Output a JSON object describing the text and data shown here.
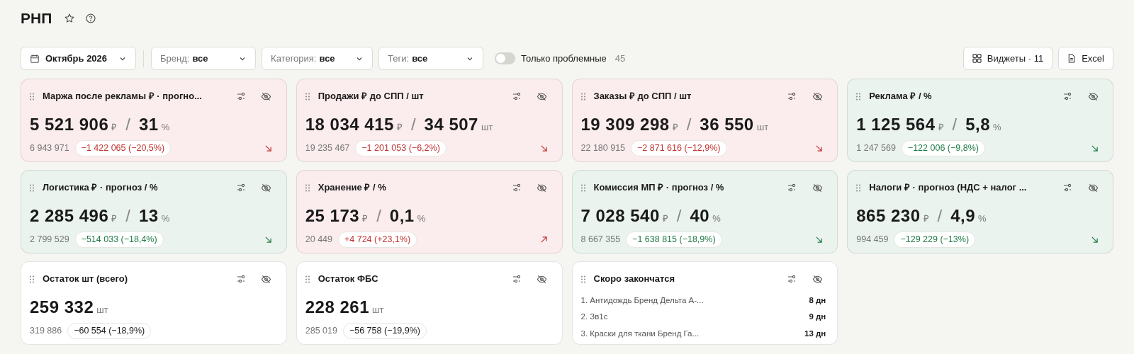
{
  "title": "РНП",
  "filters": {
    "period": "Октябрь 2026",
    "selects": [
      {
        "label": "Бренд:",
        "value": "все"
      },
      {
        "label": "Категория:",
        "value": "все"
      },
      {
        "label": "Теги:",
        "value": "все"
      }
    ],
    "problem_toggle": {
      "label": "Только проблемные",
      "on": false,
      "count": "45"
    }
  },
  "actions": [
    {
      "kind": "widgets",
      "label": "Виджеты · 11"
    },
    {
      "kind": "excel",
      "label": "Excel"
    }
  ],
  "widgets": [
    {
      "kind": "metric",
      "color": "#fbeced",
      "title": "Маржа после рекламы ₽ · прогно...",
      "value": "5 521 906",
      "unit": "₽",
      "separator": "/",
      "value2": "31",
      "unit2": "%",
      "previous": "6 943 971",
      "delta": {
        "text": "−1 422 065 (−20,5%)",
        "color": "#c0332f"
      },
      "arrow": {
        "kind": "down"
      }
    },
    {
      "kind": "metric",
      "color": "#fbeced",
      "title": "Продажи ₽ до СПП / шт",
      "value": "18 034 415",
      "unit": "₽",
      "separator": "/",
      "value2": "34 507",
      "unit2": "шт",
      "previous": "19 235 467",
      "delta": {
        "text": "−1 201 053 (−6,2%)",
        "color": "#c0332f"
      },
      "arrow": {
        "kind": "down"
      }
    },
    {
      "kind": "metric",
      "color": "#fbeced",
      "title": "Заказы ₽ до СПП / шт",
      "value": "19 309 298",
      "unit": "₽",
      "separator": "/",
      "value2": "36 550",
      "unit2": "шт",
      "previous": "22 180 915",
      "delta": {
        "text": "−2 871 616 (−12,9%)",
        "color": "#c0332f"
      },
      "arrow": {
        "kind": "down"
      }
    },
    {
      "kind": "metric",
      "color": "#eaf3ee",
      "title": "Реклама ₽ / %",
      "value": "1 125 564",
      "unit": "₽",
      "separator": "/",
      "value2": "5,8",
      "unit2": "%",
      "previous": "1 247 569",
      "delta": {
        "text": "−122 006 (−9,8%)",
        "color": "#1f7a45"
      },
      "arrow": {
        "kind": "down"
      }
    },
    {
      "kind": "metric",
      "color": "#eaf3ee",
      "title": "Логистика ₽ · прогноз / %",
      "value": "2 285 496",
      "unit": "₽",
      "separator": "/",
      "value2": "13",
      "unit2": "%",
      "previous": "2 799 529",
      "delta": {
        "text": "−514 033 (−18,4%)",
        "color": "#1f7a45"
      },
      "arrow": {
        "kind": "down"
      }
    },
    {
      "kind": "metric",
      "color": "#fbeced",
      "title": "Хранение ₽ / %",
      "value": "25 173",
      "unit": "₽",
      "separator": "/",
      "value2": "0,1",
      "unit2": "%",
      "previous": "20 449",
      "delta": {
        "text": "+4 724 (+23,1%)",
        "color": "#c0332f"
      },
      "arrow": {
        "kind": "up"
      }
    },
    {
      "kind": "metric",
      "color": "#eaf3ee",
      "title": "Комиссия МП ₽ · прогноз / %",
      "value": "7 028 540",
      "unit": "₽",
      "separator": "/",
      "value2": "40",
      "unit2": "%",
      "previous": "8 667 355",
      "delta": {
        "text": "−1 638 815 (−18,9%)",
        "color": "#1f7a45"
      },
      "arrow": {
        "kind": "down"
      }
    },
    {
      "kind": "metric",
      "color": "#eaf3ee",
      "title": "Налоги ₽ · прогноз (НДС + налог ...",
      "value": "865 230",
      "unit": "₽",
      "separator": "/",
      "value2": "4,9",
      "unit2": "%",
      "previous": "994 459",
      "delta": {
        "text": "−129 229 (−13%)",
        "color": "#1f7a45"
      },
      "arrow": {
        "kind": "down"
      }
    },
    {
      "kind": "metric",
      "color": "#ffffff",
      "title": "Остаток шт (всего)",
      "value": "259 332",
      "unit": "шт",
      "previous": "319 886",
      "delta": {
        "text": "−60 554 (−18,9%)",
        "color": "#1a1a1a"
      }
    },
    {
      "kind": "metric",
      "color": "#ffffff",
      "title": "Остаток ФБС",
      "value": "228 261",
      "unit": "шт",
      "previous": "285 019",
      "delta": {
        "text": "−56 758 (−19,9%)",
        "color": "#1a1a1a"
      }
    },
    {
      "kind": "list",
      "color": "#ffffff",
      "title": "Скоро закончатся",
      "items": [
        {
          "name": "1. Антидождь Бренд Дельта А-...",
          "days": "8 дн"
        },
        {
          "name": "2. Зв1с",
          "days": "9 дн"
        },
        {
          "name": "3. Краски для ткани Бренд Га...",
          "days": "13 дн"
        }
      ]
    }
  ]
}
